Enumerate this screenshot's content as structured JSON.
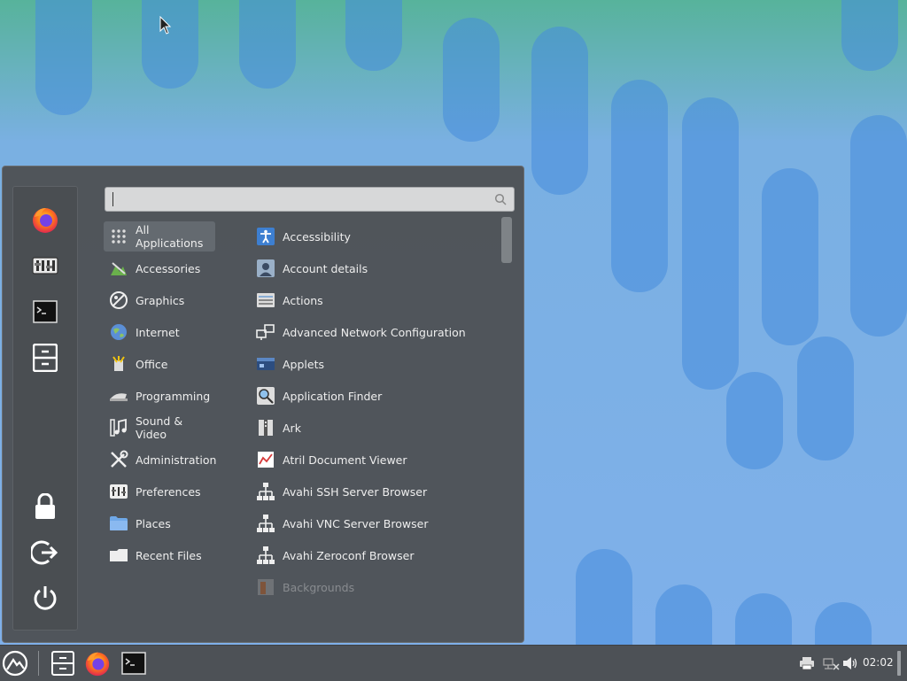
{
  "menu": {
    "search": {
      "value": "",
      "placeholder": ""
    },
    "favorites": [
      {
        "name": "firefox-icon"
      },
      {
        "name": "system-settings-icon"
      },
      {
        "name": "terminal-icon"
      },
      {
        "name": "file-manager-icon"
      }
    ],
    "session": [
      {
        "name": "lock-screen-icon"
      },
      {
        "name": "logout-icon"
      },
      {
        "name": "power-icon"
      }
    ],
    "categories": [
      {
        "label": "All Applications",
        "icon": "grid-icon",
        "selected": true
      },
      {
        "label": "Accessories",
        "icon": "accessories-icon"
      },
      {
        "label": "Graphics",
        "icon": "graphics-icon"
      },
      {
        "label": "Internet",
        "icon": "globe-icon"
      },
      {
        "label": "Office",
        "icon": "office-icon"
      },
      {
        "label": "Programming",
        "icon": "programming-icon"
      },
      {
        "label": "Sound & Video",
        "icon": "sound-video-icon"
      },
      {
        "label": "Administration",
        "icon": "tools-icon"
      },
      {
        "label": "Preferences",
        "icon": "preferences-icon"
      },
      {
        "label": "Places",
        "icon": "folder-icon"
      },
      {
        "label": "Recent Files",
        "icon": "recent-files-icon"
      }
    ],
    "apps": [
      {
        "label": "Accessibility",
        "icon": "accessibility-icon"
      },
      {
        "label": "Account details",
        "icon": "account-icon"
      },
      {
        "label": "Actions",
        "icon": "actions-icon"
      },
      {
        "label": "Advanced Network Configuration",
        "icon": "network-icon"
      },
      {
        "label": "Applets",
        "icon": "applets-icon"
      },
      {
        "label": "Application Finder",
        "icon": "finder-icon"
      },
      {
        "label": "Ark",
        "icon": "ark-icon"
      },
      {
        "label": "Atril Document Viewer",
        "icon": "document-viewer-icon"
      },
      {
        "label": "Avahi SSH Server Browser",
        "icon": "avahi-icon"
      },
      {
        "label": "Avahi VNC Server Browser",
        "icon": "avahi-icon"
      },
      {
        "label": "Avahi Zeroconf Browser",
        "icon": "avahi-icon"
      },
      {
        "label": "Backgrounds",
        "icon": "backgrounds-icon",
        "faded": true
      }
    ]
  },
  "panel": {
    "clock": "02:02"
  },
  "colors": {
    "menu_bg": "#4e5256",
    "panel_bg": "#4d5156",
    "selection": "#646a70",
    "text": "#eeeeee"
  }
}
